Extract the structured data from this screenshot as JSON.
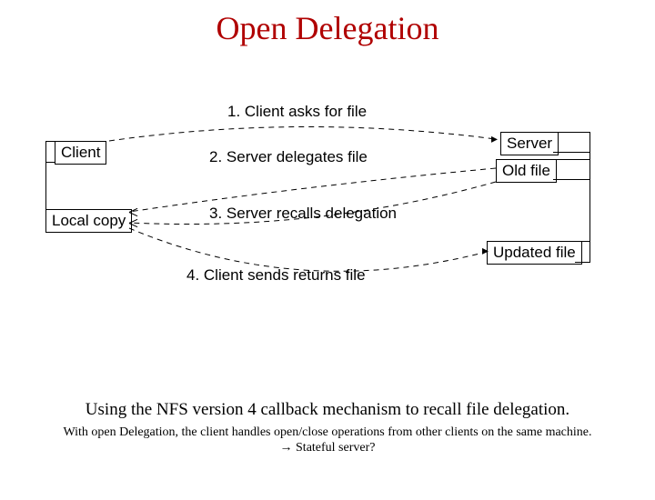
{
  "title": "Open Delegation",
  "diagram": {
    "client_label": "Client",
    "local_copy_label": "Local copy",
    "server_label": "Server",
    "old_file_label": "Old file",
    "updated_file_label": "Updated file",
    "steps": {
      "s1": "1. Client asks for file",
      "s2": "2. Server delegates file",
      "s3": "3. Server recalls delegation",
      "s4": "4. Client sends returns file"
    }
  },
  "caption": "Using the NFS version 4 callback mechanism to recall file delegation.",
  "subcaption_line1": "With open Delegation, the client handles open/close operations from other clients on the same machine.",
  "subcaption_line2_prefix": "→ Stateful server?",
  "colors": {
    "title": "#b00000"
  }
}
